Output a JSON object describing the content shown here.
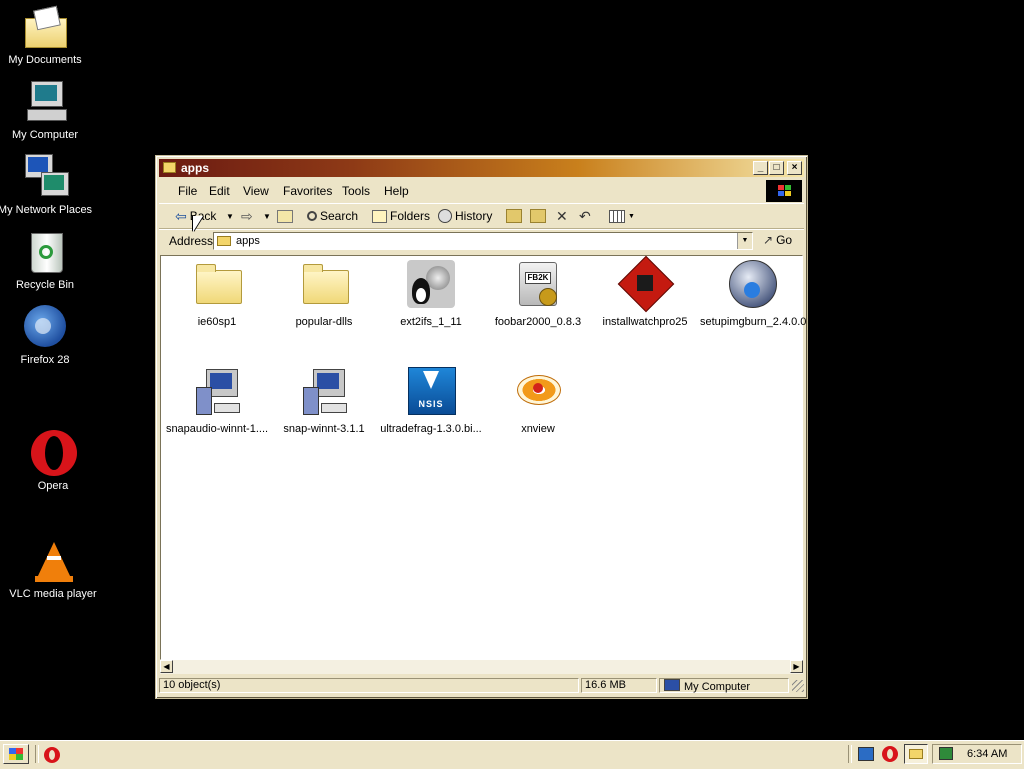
{
  "desktop": {
    "icons": [
      {
        "label": "My Documents"
      },
      {
        "label": "My Computer"
      },
      {
        "label": "My Network Places"
      },
      {
        "label": "Recycle Bin"
      },
      {
        "label": "Firefox 28"
      },
      {
        "label": "Opera"
      },
      {
        "label": "VLC media player"
      }
    ]
  },
  "window": {
    "title": "apps",
    "menu": [
      "File",
      "Edit",
      "View",
      "Favorites",
      "Tools",
      "Help"
    ],
    "toolbar": {
      "back": "Back",
      "search": "Search",
      "folders": "Folders",
      "history": "History"
    },
    "address": {
      "label": "Address",
      "value": "apps",
      "go": "Go"
    },
    "items": [
      {
        "label": "ie60sp1",
        "icon": "folder-icon"
      },
      {
        "label": "popular-dlls",
        "icon": "folder-icon"
      },
      {
        "label": "ext2ifs_1_11",
        "icon": "ext2ifs-installer-icon"
      },
      {
        "label": "foobar2000_0.8.3",
        "icon": "foobar2000-installer-icon"
      },
      {
        "label": "installwatchpro25",
        "icon": "installwatch-icon"
      },
      {
        "label": "setupimgburn_2.4.0.0",
        "icon": "imgburn-icon"
      },
      {
        "label": "snapaudio-winnt-1....",
        "icon": "setup-computer-icon"
      },
      {
        "label": "snap-winnt-3.1.1",
        "icon": "setup-computer-icon"
      },
      {
        "label": "ultradefrag-1.3.0.bi...",
        "icon": "nsis-installer-icon",
        "badge": "NSIS"
      },
      {
        "label": "xnview",
        "icon": "xnview-icon"
      }
    ],
    "status": {
      "objects": "10 object(s)",
      "size": "16.6 MB",
      "zone": "My Computer"
    }
  },
  "taskbar": {
    "clock": "6:34 AM"
  }
}
